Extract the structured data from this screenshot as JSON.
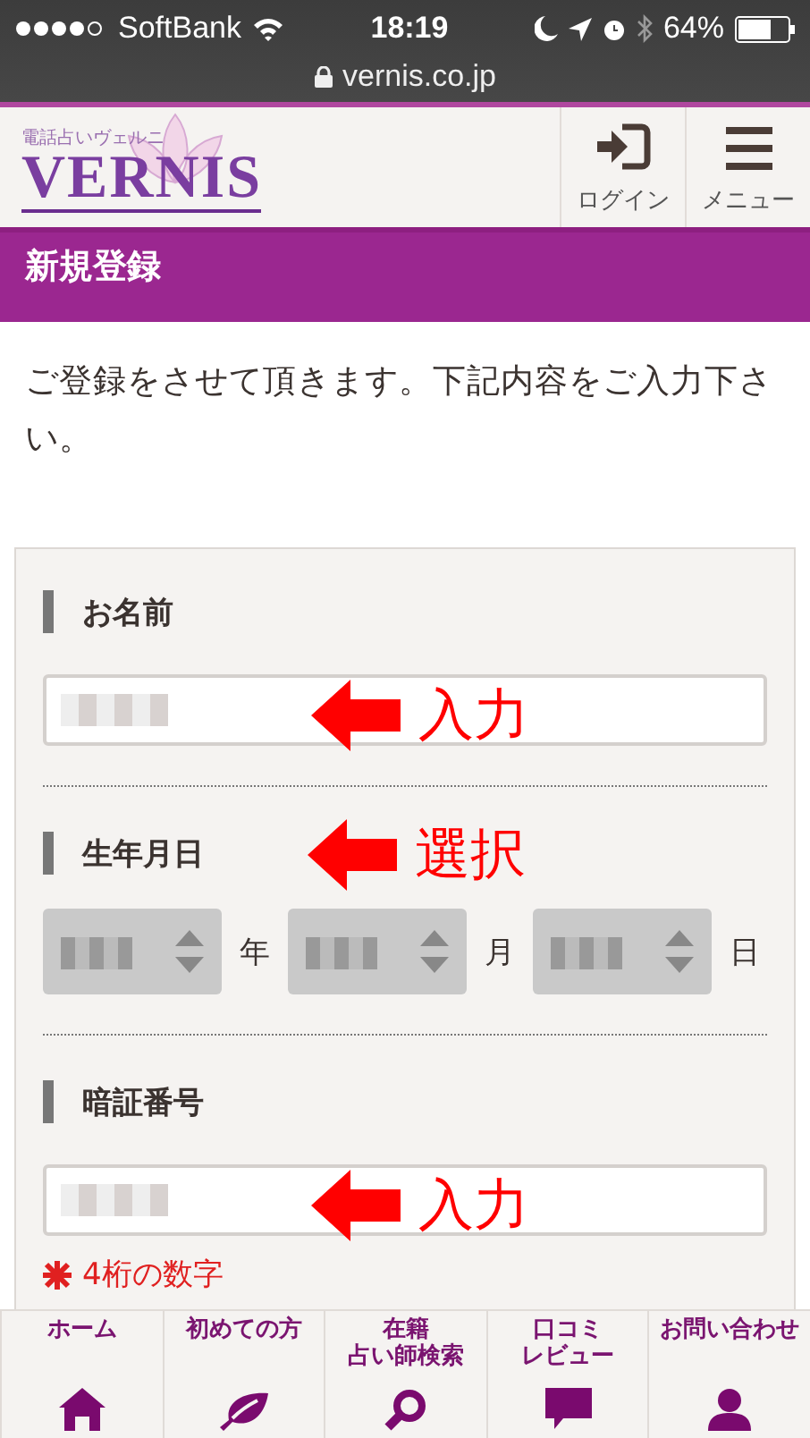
{
  "status_bar": {
    "carrier": "SoftBank",
    "time": "18:19",
    "battery": "64%"
  },
  "browser": {
    "url": "vernis.co.jp"
  },
  "header": {
    "logo_tagline": "電話占いヴェルニ",
    "logo": "VERNIS",
    "buttons": [
      {
        "label": "ログイン",
        "kind": "login"
      },
      {
        "label": "メニュー",
        "kind": "menu"
      }
    ]
  },
  "page_title": "新規登録",
  "intro": "ご登録をさせて頂きます。下記内容をご入力下さい。",
  "form": {
    "fields": [
      {
        "label": "お名前",
        "kind": "text",
        "annotation": "入力"
      },
      {
        "label": "生年月日",
        "kind": "date",
        "annotation": "選択",
        "units": [
          "年",
          "月",
          "日"
        ]
      },
      {
        "label": "暗証番号",
        "kind": "text",
        "annotation": "入力",
        "note": "4桁の数字"
      }
    ]
  },
  "bottom_nav": [
    {
      "label": "ホーム",
      "kind": "home"
    },
    {
      "label": "初めての方",
      "kind": "leaf"
    },
    {
      "lines": [
        "在籍",
        "占い師検索"
      ],
      "kind": "search"
    },
    {
      "lines": [
        "口コミ",
        "レビュー"
      ],
      "kind": "chat"
    },
    {
      "label": "お問い合わせ",
      "kind": "person"
    }
  ]
}
